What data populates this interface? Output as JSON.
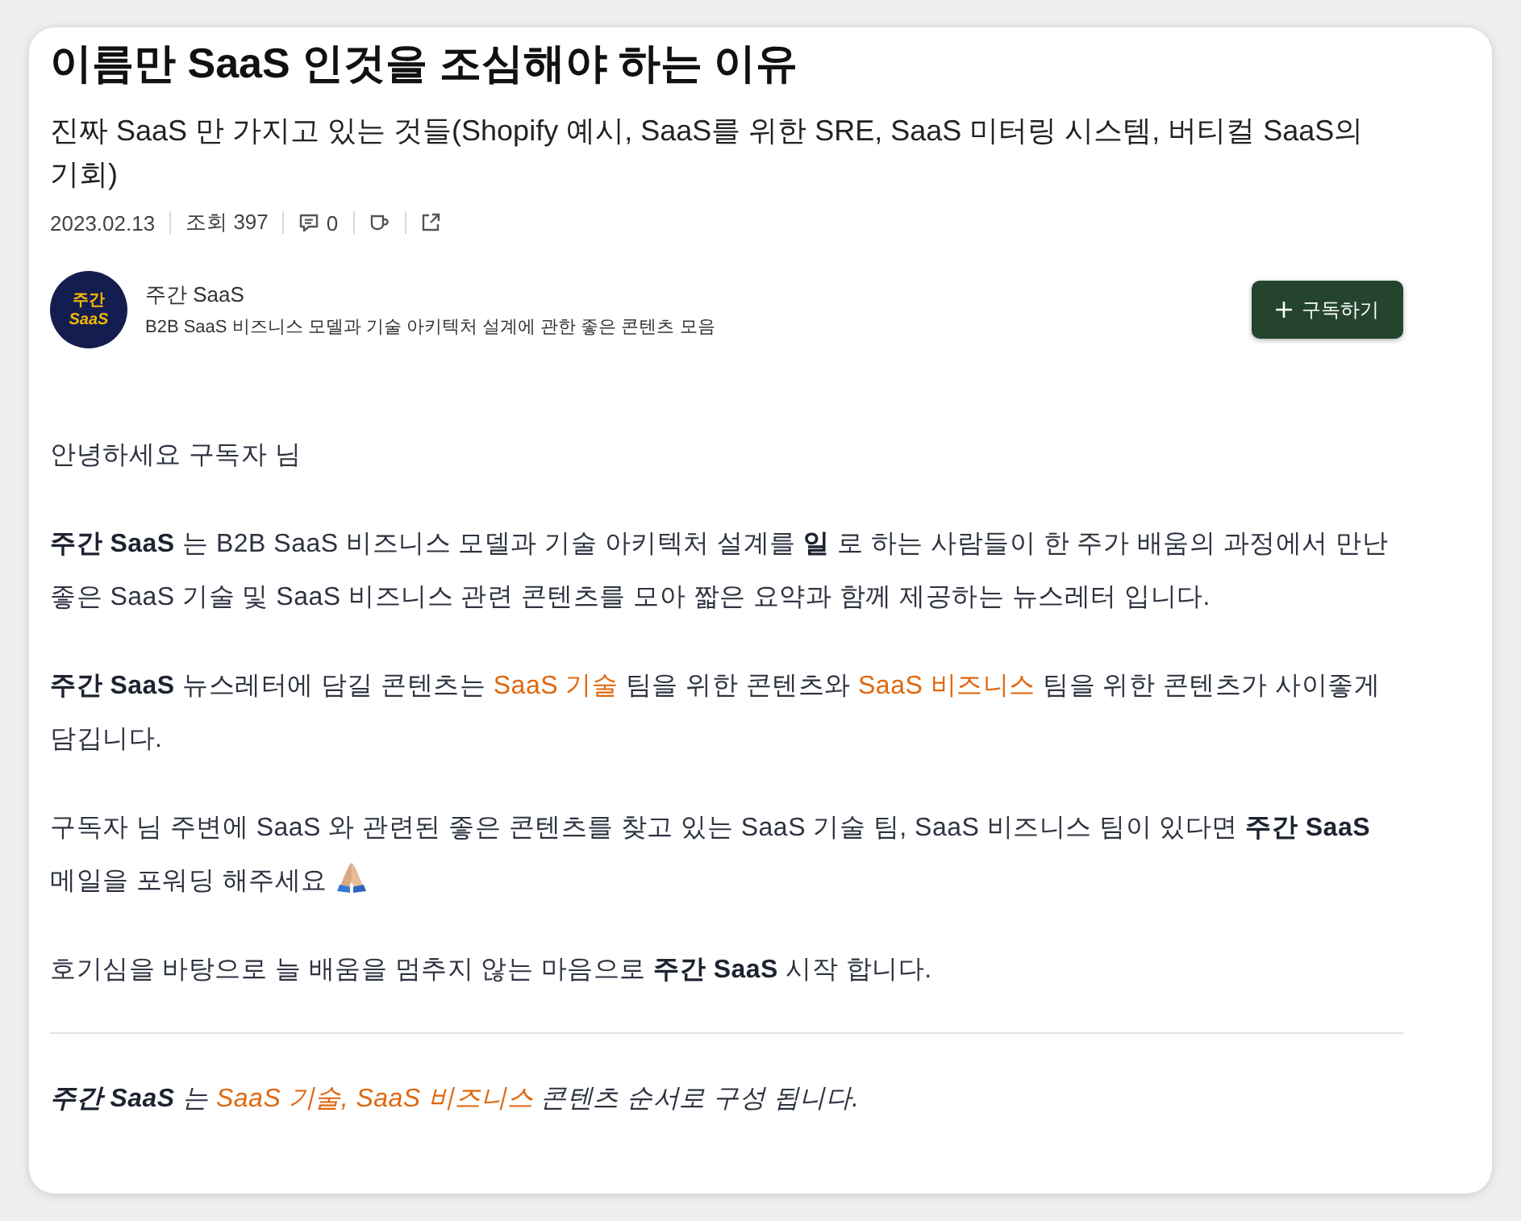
{
  "article": {
    "title": "이름만 SaaS 인것을 조심해야 하는 이유",
    "subtitle": "진짜 SaaS 만 가지고 있는 것들(Shopify 예시, SaaS를 위한 SRE, SaaS 미터링 시스템, 버티컬 SaaS의 기회)",
    "meta": {
      "date": "2023.02.13",
      "views": "조회 397",
      "comments": "0"
    }
  },
  "publisher": {
    "avatar": {
      "line_1": "주간",
      "line_2": "SaaS"
    },
    "name": "주간 SaaS",
    "description": "B2B SaaS 비즈니스 모델과 기술 아키텍처 설계에 관한 좋은 콘텐츠 모음",
    "subscribe_button": "구독하기"
  },
  "body": [
    {
      "kind": "paragraph",
      "parts": [
        {
          "kind": "text",
          "text": "안녕하세요 구독자 님"
        }
      ]
    },
    {
      "kind": "paragraph",
      "parts": [
        {
          "kind": "text",
          "text": "**주간 SaaS** 는 B2B SaaS 비즈니스 모델과 기술 아키텍처 설계를 **일** 로 하는 사람들이 한 주가 배움의 과정에서 만난 좋은 SaaS 기술 및 SaaS 비즈니스 관련 콘텐츠를 모아 짧은 요약과 함께 제공하는 뉴스레터 입니다."
        }
      ]
    },
    {
      "kind": "paragraph",
      "parts": [
        {
          "kind": "text",
          "text": "**주간 SaaS** 뉴스레터에 담길 콘텐츠는 "
        },
        {
          "kind": "highlight",
          "text": "SaaS 기술"
        },
        {
          "kind": "text",
          "text": " 팀을 위한 콘텐츠와 "
        },
        {
          "kind": "highlight",
          "text": "SaaS 비즈니스"
        },
        {
          "kind": "text",
          "text": " 팀을 위한 콘텐츠가 사이좋게 담깁니다."
        }
      ]
    },
    {
      "kind": "paragraph",
      "parts": [
        {
          "kind": "text",
          "text": "구독자 님 주변에 SaaS 와 관련된 좋은 콘텐츠를 찾고 있는 SaaS 기술 팀, SaaS 비즈니스 팀이 있다면 **주간 SaaS** 메일을 포워딩 해주세요 "
        },
        {
          "kind": "icon"
        }
      ]
    },
    {
      "kind": "paragraph",
      "parts": [
        {
          "kind": "text",
          "text": "호기심을 바탕으로 늘 배움을 멈추지 않는 마음으로 **주간 SaaS** 시작 합니다."
        }
      ]
    },
    {
      "kind": "divider"
    },
    {
      "kind": "note",
      "parts": [
        {
          "kind": "text",
          "text": "**주간 SaaS** 는 "
        },
        {
          "kind": "highlight",
          "text": "SaaS 기술, SaaS 비즈니스"
        },
        {
          "kind": "text",
          "text": " 콘텐츠 순서로 구성 됩니다."
        }
      ]
    }
  ]
}
